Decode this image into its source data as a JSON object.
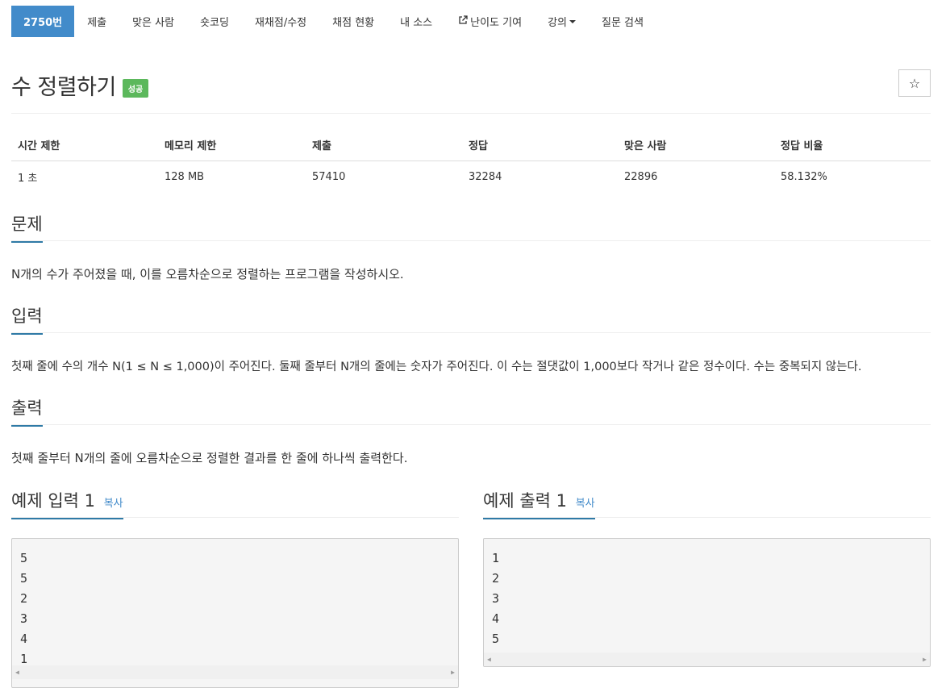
{
  "nav": {
    "items": [
      {
        "label": "2750번",
        "active": true
      },
      {
        "label": "제출"
      },
      {
        "label": "맞은 사람"
      },
      {
        "label": "숏코딩"
      },
      {
        "label": "재채점/수정"
      },
      {
        "label": "채점 현황"
      },
      {
        "label": "내 소스"
      },
      {
        "label": "난이도 기여",
        "icon": "external-link-icon"
      },
      {
        "label": "강의",
        "icon": "caret-down-icon"
      },
      {
        "label": "질문 검색"
      }
    ]
  },
  "problem": {
    "title": "수 정렬하기",
    "badge": "성공",
    "star_icon": "☆"
  },
  "info_table": {
    "headers": [
      "시간 제한",
      "메모리 제한",
      "제출",
      "정답",
      "맞은 사람",
      "정답 비율"
    ],
    "row": [
      "1 초",
      "128 MB",
      "57410",
      "32284",
      "22896",
      "58.132%"
    ]
  },
  "sections": {
    "problem": {
      "title": "문제",
      "text": "N개의 수가 주어졌을 때, 이를 오름차순으로 정렬하는 프로그램을 작성하시오."
    },
    "input": {
      "title": "입력",
      "text": "첫째 줄에 수의 개수 N(1 ≤ N ≤ 1,000)이 주어진다. 둘째 줄부터 N개의 줄에는 숫자가 주어진다. 이 수는 절댓값이 1,000보다 작거나 같은 정수이다. 수는 중복되지 않는다."
    },
    "output": {
      "title": "출력",
      "text": "첫째 줄부터 N개의 줄에 오름차순으로 정렬한 결과를 한 줄에 하나씩 출력한다."
    }
  },
  "samples": {
    "input": {
      "title": "예제 입력 1",
      "copy": "복사",
      "lines": [
        "5",
        "5",
        "2",
        "3",
        "4",
        "1"
      ]
    },
    "output": {
      "title": "예제 출력 1",
      "copy": "복사",
      "lines": [
        "1",
        "2",
        "3",
        "4",
        "5"
      ]
    }
  },
  "colors": {
    "accent": "#428bca",
    "success": "#5cb85c",
    "underline": "#2f7aa6"
  }
}
